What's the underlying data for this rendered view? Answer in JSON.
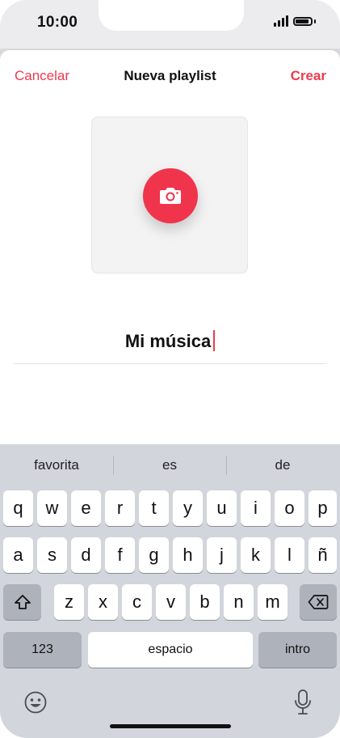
{
  "status_bar": {
    "time": "10:00"
  },
  "nav": {
    "cancel_label": "Cancelar",
    "title": "Nueva playlist",
    "create_label": "Crear"
  },
  "artwork": {
    "icon": "camera-icon"
  },
  "playlist_name": {
    "value": "Mi música"
  },
  "keyboard": {
    "suggestions": [
      "favorita",
      "es",
      "de"
    ],
    "row1": [
      "q",
      "w",
      "e",
      "r",
      "t",
      "y",
      "u",
      "i",
      "o",
      "p"
    ],
    "row2": [
      "a",
      "s",
      "d",
      "f",
      "g",
      "h",
      "j",
      "k",
      "l",
      "ñ"
    ],
    "row3": [
      "z",
      "x",
      "c",
      "v",
      "b",
      "n",
      "m"
    ],
    "numbers_label": "123",
    "space_label": "espacio",
    "return_label": "intro"
  },
  "colors": {
    "accent": "#f0394e",
    "keyboard_bg": "#d2d5db"
  }
}
